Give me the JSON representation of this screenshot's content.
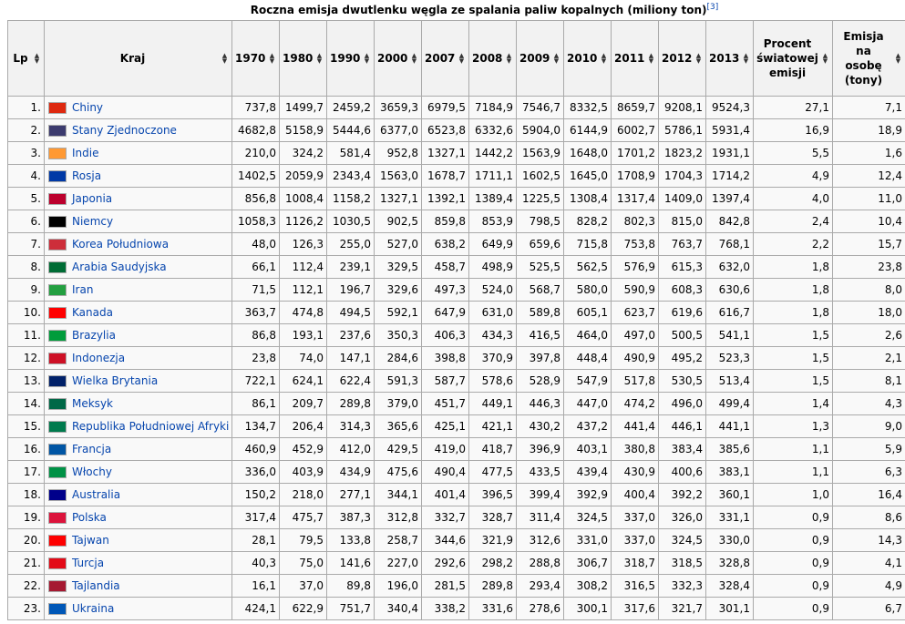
{
  "caption": {
    "title": "Roczna emisja dwutlenku węgla ze spalania paliw kopalnych (miliony ton)",
    "ref": "[3]"
  },
  "headers": {
    "lp": "Lp",
    "kraj": "Kraj",
    "years": [
      "1970",
      "1980",
      "1990",
      "2000",
      "2007",
      "2008",
      "2009",
      "2010",
      "2011",
      "2012",
      "2013"
    ],
    "percent": "Procent światowej emisji",
    "per_capita": "Emisja na osobę (tony)"
  },
  "sort_icon": "sort-arrows-icon",
  "rows": [
    {
      "lp": "1.",
      "country": "Chiny",
      "flag": "#de2910",
      "values": [
        "737,8",
        "1499,7",
        "2459,2",
        "3659,3",
        "6979,5",
        "7184,9",
        "7546,7",
        "8332,5",
        "8659,7",
        "9208,1",
        "9524,3"
      ],
      "percent": "27,1",
      "per_capita": "7,1"
    },
    {
      "lp": "2.",
      "country": "Stany Zjednoczone",
      "flag": "#3c3b6e",
      "values": [
        "4682,8",
        "5158,9",
        "5444,6",
        "6377,0",
        "6523,8",
        "6332,6",
        "5904,0",
        "6144,9",
        "6002,7",
        "5786,1",
        "5931,4"
      ],
      "percent": "16,9",
      "per_capita": "18,9"
    },
    {
      "lp": "3.",
      "country": "Indie",
      "flag": "#ff9933",
      "values": [
        "210,0",
        "324,2",
        "581,4",
        "952,8",
        "1327,1",
        "1442,2",
        "1563,9",
        "1648,0",
        "1701,2",
        "1823,2",
        "1931,1"
      ],
      "percent": "5,5",
      "per_capita": "1,6"
    },
    {
      "lp": "4.",
      "country": "Rosja",
      "flag": "#0039a6",
      "values": [
        "1402,5",
        "2059,9",
        "2343,4",
        "1563,0",
        "1678,7",
        "1711,1",
        "1602,5",
        "1645,0",
        "1708,9",
        "1704,3",
        "1714,2"
      ],
      "percent": "4,9",
      "per_capita": "12,4"
    },
    {
      "lp": "5.",
      "country": "Japonia",
      "flag": "#bc002d",
      "values": [
        "856,8",
        "1008,4",
        "1158,2",
        "1327,1",
        "1392,1",
        "1389,4",
        "1225,5",
        "1308,4",
        "1317,4",
        "1409,0",
        "1397,4"
      ],
      "percent": "4,0",
      "per_capita": "11,0"
    },
    {
      "lp": "6.",
      "country": "Niemcy",
      "flag": "#000000",
      "values": [
        "1058,3",
        "1126,2",
        "1030,5",
        "902,5",
        "859,8",
        "853,9",
        "798,5",
        "828,2",
        "802,3",
        "815,0",
        "842,8"
      ],
      "percent": "2,4",
      "per_capita": "10,4"
    },
    {
      "lp": "7.",
      "country": "Korea Południowa",
      "flag": "#cd2e3a",
      "values": [
        "48,0",
        "126,3",
        "255,0",
        "527,0",
        "638,2",
        "649,9",
        "659,6",
        "715,8",
        "753,8",
        "763,7",
        "768,1"
      ],
      "percent": "2,2",
      "per_capita": "15,7"
    },
    {
      "lp": "8.",
      "country": "Arabia Saudyjska",
      "flag": "#006c35",
      "values": [
        "66,1",
        "112,4",
        "239,1",
        "329,5",
        "458,7",
        "498,9",
        "525,5",
        "562,5",
        "576,9",
        "615,3",
        "632,0"
      ],
      "percent": "1,8",
      "per_capita": "23,8"
    },
    {
      "lp": "9.",
      "country": "Iran",
      "flag": "#239f40",
      "values": [
        "71,5",
        "112,1",
        "196,7",
        "329,6",
        "497,3",
        "524,0",
        "568,7",
        "580,0",
        "590,9",
        "608,3",
        "630,6"
      ],
      "percent": "1,8",
      "per_capita": "8,0"
    },
    {
      "lp": "10.",
      "country": "Kanada",
      "flag": "#ff0000",
      "values": [
        "363,7",
        "474,8",
        "494,5",
        "592,1",
        "647,9",
        "631,0",
        "589,8",
        "605,1",
        "623,7",
        "619,6",
        "616,7"
      ],
      "percent": "1,8",
      "per_capita": "18,0"
    },
    {
      "lp": "11.",
      "country": "Brazylia",
      "flag": "#009c3b",
      "values": [
        "86,8",
        "193,1",
        "237,6",
        "350,3",
        "406,3",
        "434,3",
        "416,5",
        "464,0",
        "497,0",
        "500,5",
        "541,1"
      ],
      "percent": "1,5",
      "per_capita": "2,6"
    },
    {
      "lp": "12.",
      "country": "Indonezja",
      "flag": "#ce1126",
      "values": [
        "23,8",
        "74,0",
        "147,1",
        "284,6",
        "398,8",
        "370,9",
        "397,8",
        "448,4",
        "490,9",
        "495,2",
        "523,3"
      ],
      "percent": "1,5",
      "per_capita": "2,1"
    },
    {
      "lp": "13.",
      "country": "Wielka Brytania",
      "flag": "#012169",
      "values": [
        "722,1",
        "624,1",
        "622,4",
        "591,3",
        "587,7",
        "578,6",
        "528,9",
        "547,9",
        "517,8",
        "530,5",
        "513,4"
      ],
      "percent": "1,5",
      "per_capita": "8,1"
    },
    {
      "lp": "14.",
      "country": "Meksyk",
      "flag": "#006847",
      "values": [
        "86,1",
        "209,7",
        "289,8",
        "379,0",
        "451,7",
        "449,1",
        "446,3",
        "447,0",
        "474,2",
        "496,0",
        "499,4"
      ],
      "percent": "1,4",
      "per_capita": "4,3"
    },
    {
      "lp": "15.",
      "country": "Republika Południowej Afryki",
      "flag": "#007a4d",
      "values": [
        "134,7",
        "206,4",
        "314,3",
        "365,6",
        "425,1",
        "421,1",
        "430,2",
        "437,2",
        "441,4",
        "446,1",
        "441,1"
      ],
      "percent": "1,3",
      "per_capita": "9,0"
    },
    {
      "lp": "16.",
      "country": "Francja",
      "flag": "#0055a4",
      "values": [
        "460,9",
        "452,9",
        "412,0",
        "429,5",
        "419,0",
        "418,7",
        "396,9",
        "403,1",
        "380,8",
        "383,4",
        "385,6"
      ],
      "percent": "1,1",
      "per_capita": "5,9"
    },
    {
      "lp": "17.",
      "country": "Włochy",
      "flag": "#009246",
      "values": [
        "336,0",
        "403,9",
        "434,9",
        "475,6",
        "490,4",
        "477,5",
        "433,5",
        "439,4",
        "430,9",
        "400,6",
        "383,1"
      ],
      "percent": "1,1",
      "per_capita": "6,3"
    },
    {
      "lp": "18.",
      "country": "Australia",
      "flag": "#00008b",
      "values": [
        "150,2",
        "218,0",
        "277,1",
        "344,1",
        "401,4",
        "396,5",
        "399,4",
        "392,9",
        "400,4",
        "392,2",
        "360,1"
      ],
      "percent": "1,0",
      "per_capita": "16,4"
    },
    {
      "lp": "19.",
      "country": "Polska",
      "flag": "#dc143c",
      "values": [
        "317,4",
        "475,7",
        "387,3",
        "312,8",
        "332,7",
        "328,7",
        "311,4",
        "324,5",
        "337,0",
        "326,0",
        "331,1"
      ],
      "percent": "0,9",
      "per_capita": "8,6"
    },
    {
      "lp": "20.",
      "country": "Tajwan",
      "flag": "#fe0000",
      "values": [
        "28,1",
        "79,5",
        "133,8",
        "258,7",
        "344,6",
        "321,9",
        "312,6",
        "331,0",
        "337,0",
        "324,5",
        "330,0"
      ],
      "percent": "0,9",
      "per_capita": "14,3"
    },
    {
      "lp": "21.",
      "country": "Turcja",
      "flag": "#e30a17",
      "values": [
        "40,3",
        "75,0",
        "141,6",
        "227,0",
        "292,6",
        "298,2",
        "288,8",
        "306,7",
        "318,7",
        "318,5",
        "328,8"
      ],
      "percent": "0,9",
      "per_capita": "4,1"
    },
    {
      "lp": "22.",
      "country": "Tajlandia",
      "flag": "#a51931",
      "values": [
        "16,1",
        "37,0",
        "89,8",
        "196,0",
        "281,5",
        "289,8",
        "293,4",
        "308,2",
        "316,5",
        "332,3",
        "328,4"
      ],
      "percent": "0,9",
      "per_capita": "4,9"
    },
    {
      "lp": "23.",
      "country": "Ukraina",
      "flag": "#0057b7",
      "values": [
        "424,1",
        "622,9",
        "751,7",
        "340,4",
        "338,2",
        "331,6",
        "278,6",
        "300,1",
        "317,6",
        "321,7",
        "301,1"
      ],
      "percent": "0,9",
      "per_capita": "6,7"
    }
  ]
}
